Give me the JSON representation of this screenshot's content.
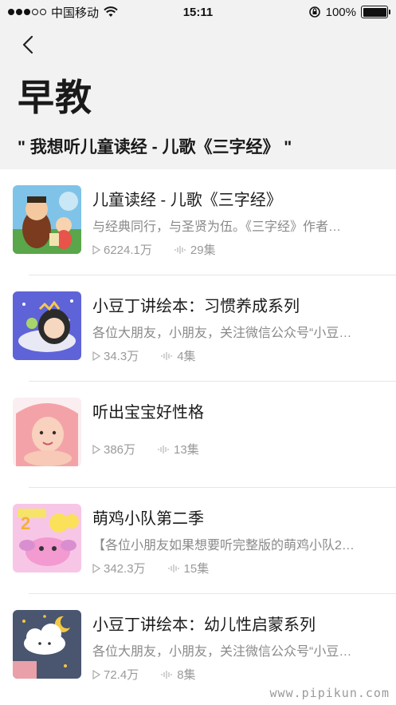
{
  "status_bar": {
    "carrier": "中国移动",
    "time": "15:11",
    "battery_percent": "100%",
    "battery_level": 1.0,
    "signal_bars": 3
  },
  "nav": {
    "back_icon": "chevron-left-icon"
  },
  "header": {
    "title": "早教",
    "subtitle": "\" 我想听儿童读经 - 儿歌《三字经》 \""
  },
  "items": [
    {
      "title": "儿童读经 - 儿歌《三字经》",
      "desc": "与经典同行，与圣贤为伍。《三字经》作者…",
      "plays": "6224.1万",
      "episodes": "29集"
    },
    {
      "title": "小豆丁讲绘本：习惯养成系列",
      "desc": "各位大朋友，小朋友，关注微信公众号“小豆…",
      "plays": "34.3万",
      "episodes": "4集"
    },
    {
      "title": "听出宝宝好性格",
      "desc": "",
      "plays": "386万",
      "episodes": "13集"
    },
    {
      "title": "萌鸡小队第二季",
      "desc": "【各位小朋友如果想要听完整版的萌鸡小队2…",
      "plays": "342.3万",
      "episodes": "15集"
    },
    {
      "title": "小豆丁讲绘本：幼儿性启蒙系列",
      "desc": "各位大朋友，小朋友，关注微信公众号“小豆…",
      "plays": "72.4万",
      "episodes": "8集"
    }
  ],
  "watermark": "www.pipikun.com",
  "colors": {
    "background": "#f2f2f2",
    "list_bg": "#ffffff",
    "muted_text": "#9a9a9a"
  }
}
